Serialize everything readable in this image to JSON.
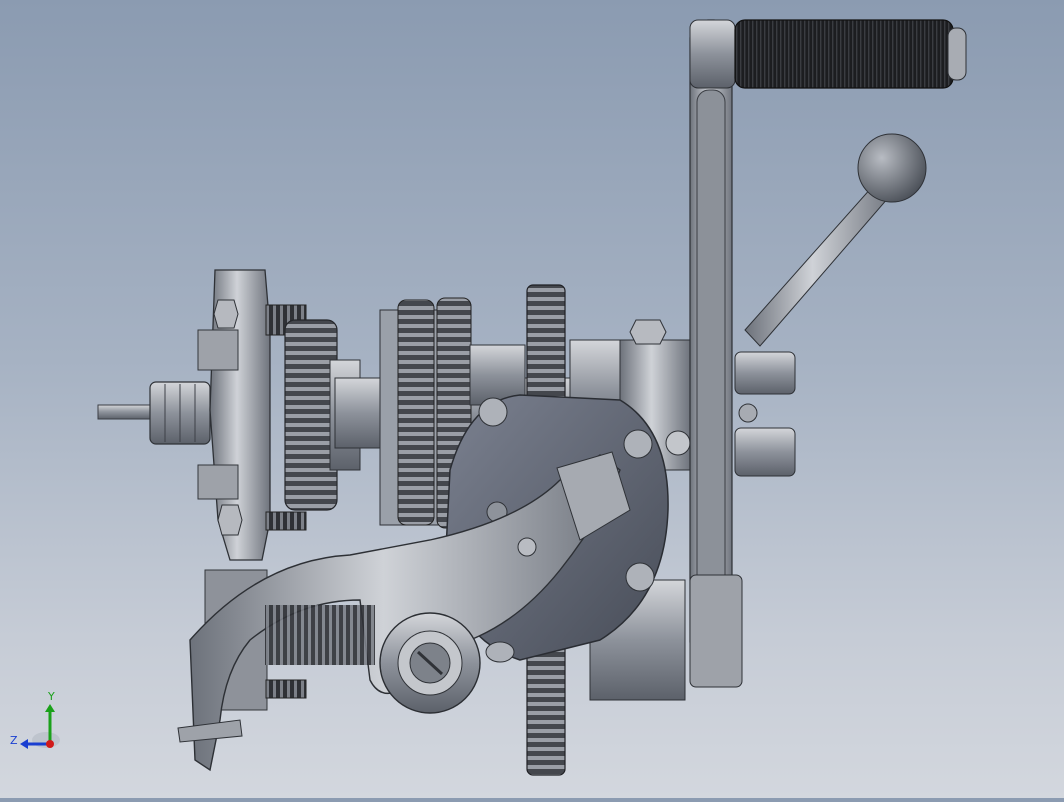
{
  "viewport": {
    "background_top": "#8b9bb1",
    "background_bottom": "#d3d7de"
  },
  "model": {
    "description_icon": "gearbox-assembly-icon",
    "colors": {
      "metal_light": "#c4c7cd",
      "metal_mid": "#8e939c",
      "metal_dark": "#4f545c",
      "rubber": "#1b1c1f",
      "housing": "#5f6572"
    }
  },
  "triad": {
    "y_label": "Y",
    "z_label": "Z",
    "x_color": "#d11a1a",
    "y_color": "#1aa11a",
    "z_color": "#1a3fd1"
  }
}
